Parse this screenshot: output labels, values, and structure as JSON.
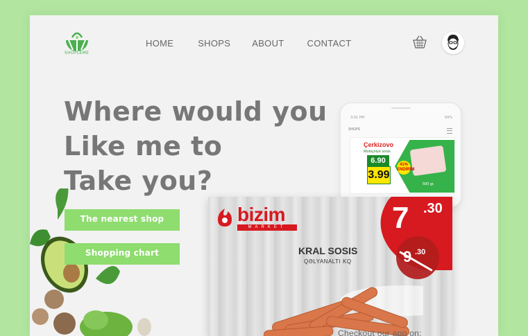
{
  "brand": {
    "name": "SHOPLEME",
    "accent": "#8fdc6f",
    "logo_green": "#4caf50"
  },
  "nav": {
    "items": [
      "HOME",
      "SHOPS",
      "ABOUT",
      "CONTACT"
    ]
  },
  "header_icons": {
    "cart": "basket-icon",
    "profile": "avatar"
  },
  "hero": {
    "headline": [
      "Where would you",
      "Like me to",
      "Take you?"
    ],
    "buttons": [
      "The nearest shop",
      "Shopping chart"
    ]
  },
  "phone": {
    "time": "3:01 PM",
    "signal": "69%",
    "screen_title": "SHOPS",
    "promo": {
      "brand": "Çerkizovo",
      "subtitle": "Molоçniye sosis",
      "old_price": "6.90",
      "new_price": "3.99",
      "discount": "41% ENDİRİM",
      "weight": "500 gr."
    }
  },
  "banner": {
    "store": "bizim",
    "store_sub": "MARKET",
    "product": "KRAL SOSIS",
    "product_sub": "QƏLYANALTI KQ",
    "price_new": "7",
    "price_new_dec": ".30",
    "price_old": "9",
    "price_old_dec": ".30"
  },
  "footer": {
    "checkout": "Checkout our app on:"
  },
  "colors": {
    "background": "#b2e6a0",
    "card": "#f2f2f2",
    "price_red": "#d71920"
  }
}
